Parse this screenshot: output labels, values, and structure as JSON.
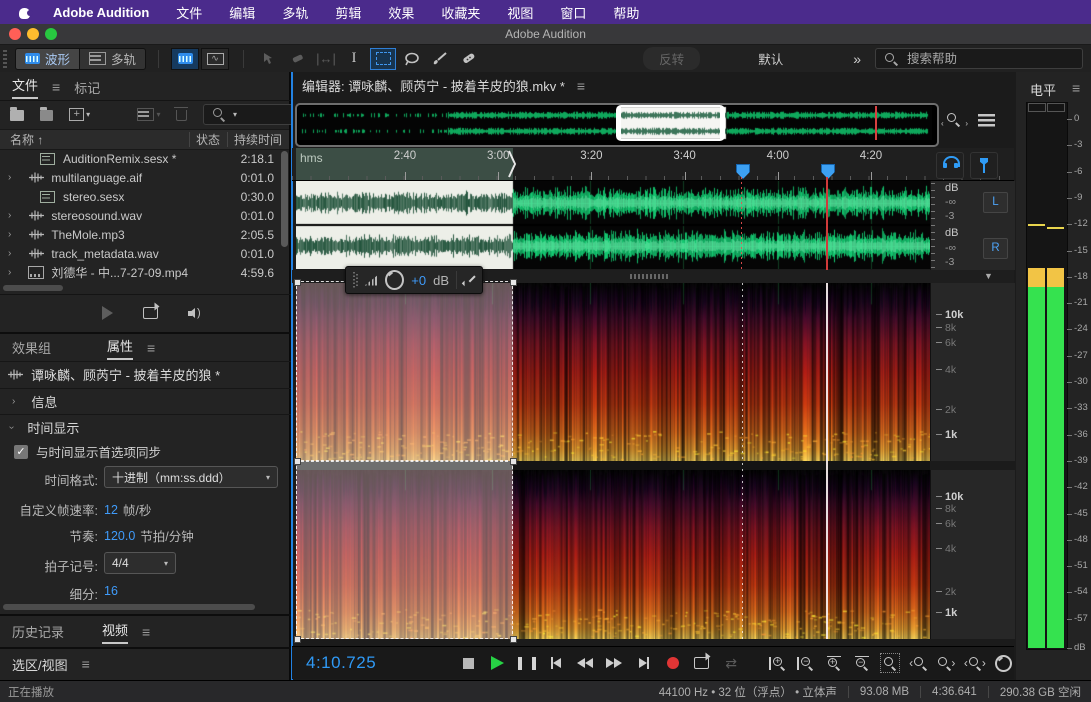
{
  "menu_bar": {
    "app_name": "Adobe Audition",
    "items": [
      "文件",
      "编辑",
      "多轨",
      "剪辑",
      "效果",
      "收藏夹",
      "视图",
      "窗口",
      "帮助"
    ]
  },
  "window": {
    "title": "Adobe Audition"
  },
  "toolbar": {
    "waveform": "波形",
    "multitrack": "多轨",
    "reverse": "反转",
    "workspace": "默认",
    "overflow": "»",
    "search_placeholder": "搜索帮助"
  },
  "files": {
    "tab_files": "文件",
    "tab_markers": "标记",
    "col_name": "名称",
    "sort_arrow": "↑",
    "col_status": "状态",
    "col_duration": "持续时间",
    "rows": [
      {
        "name": "AuditionRemix.sesx *",
        "duration": "2:18.1",
        "icon": "session-icon",
        "expandable": false
      },
      {
        "name": "multilanguage.aif",
        "duration": "0:01.0",
        "icon": "audio-icon",
        "expandable": true
      },
      {
        "name": "stereo.sesx",
        "duration": "0:30.0",
        "icon": "session-icon",
        "expandable": false
      },
      {
        "name": "stereosound.wav",
        "duration": "0:01.0",
        "icon": "audio-icon",
        "expandable": true
      },
      {
        "name": "TheMole.mp3",
        "duration": "2:05.5",
        "icon": "audio-icon",
        "expandable": true
      },
      {
        "name": "track_metadata.wav",
        "duration": "0:01.0",
        "icon": "audio-icon",
        "expandable": true
      },
      {
        "name": "刘德华 - 中...7-27-09.mp4",
        "duration": "4:59.6",
        "icon": "video-icon",
        "expandable": true
      }
    ]
  },
  "properties": {
    "tab_effects": "效果组",
    "tab_properties": "属性",
    "file_name": "谭咏麟、顾芮宁 - 披着羊皮的狼 *",
    "section_info": "信息",
    "section_time": "时间显示",
    "sync_label": "与时间显示首选项同步",
    "time_format_label": "时间格式:",
    "time_format_value": "十进制（mm:ss.ddd）",
    "framerate_label": "自定义帧速率:",
    "framerate_value": "12",
    "framerate_unit": "帧/秒",
    "tempo_label": "节奏:",
    "tempo_value": "120.0",
    "tempo_unit": "节拍/分钟",
    "signature_label": "拍子记号:",
    "signature_value": "4/4",
    "subdivision_label": "细分:",
    "subdivision_value": "16"
  },
  "bottom_left": {
    "tab_history": "历史记录",
    "tab_video": "视频",
    "selection_view": "选区/视图"
  },
  "editor": {
    "title": "编辑器: 谭咏麟、顾芮宁 - 披着羊皮的狼.mkv *",
    "ruler_unit": "hms",
    "ticks": [
      "2:40",
      "3:00",
      "3:20",
      "3:40",
      "4:00",
      "4:20"
    ],
    "db_label": "dB",
    "neg_inf": "-∞",
    "neg3": "-3",
    "channel_left": "L",
    "channel_right": "R",
    "hud_gain": "+0",
    "hud_unit": "dB",
    "freq_labels": [
      "10k",
      "8k",
      "6k",
      "4k",
      "2k",
      "1k"
    ],
    "time_display": "4:10.725",
    "accent_blue": "#2382e2",
    "waveform_green": "#14cd73"
  },
  "status_bar": {
    "playback": "正在播放",
    "format": "44100 Hz • 32 位（浮点） • 立体声",
    "size": "93.08 MB",
    "duration": "4:36.641",
    "free": "290.38 GB 空闲"
  },
  "levels": {
    "title": "电平",
    "scale": [
      "0",
      "-3",
      "-6",
      "-9",
      "-12",
      "-15",
      "-18",
      "-21",
      "-24",
      "-27",
      "-30",
      "-33",
      "-36",
      "-39",
      "-42",
      "-45",
      "-48",
      "-51",
      "-54",
      "-57"
    ],
    "unit": "dB",
    "level_db": -16.5,
    "peak_db": -12
  }
}
